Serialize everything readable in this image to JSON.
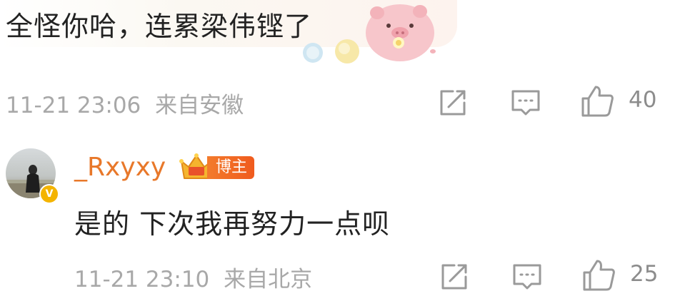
{
  "first_comment": {
    "text": "全怪你哈，连累梁伟铿了",
    "sticker": "pig-sticker-icon",
    "time": "11-21 23:06",
    "location": "来自安徽",
    "like_count": "40"
  },
  "reply": {
    "username": "_Rxyxy",
    "badge": "博主",
    "verified": "V",
    "text": "是的 下次我再努力一点呗",
    "time": "11-21 23:10",
    "location": "来自北京",
    "like_count": "25"
  },
  "colors": {
    "username": "#e8782a",
    "badge_bg": "#f37b2c",
    "meta_text": "#a8a8a8",
    "icon": "#9a9a9a"
  }
}
